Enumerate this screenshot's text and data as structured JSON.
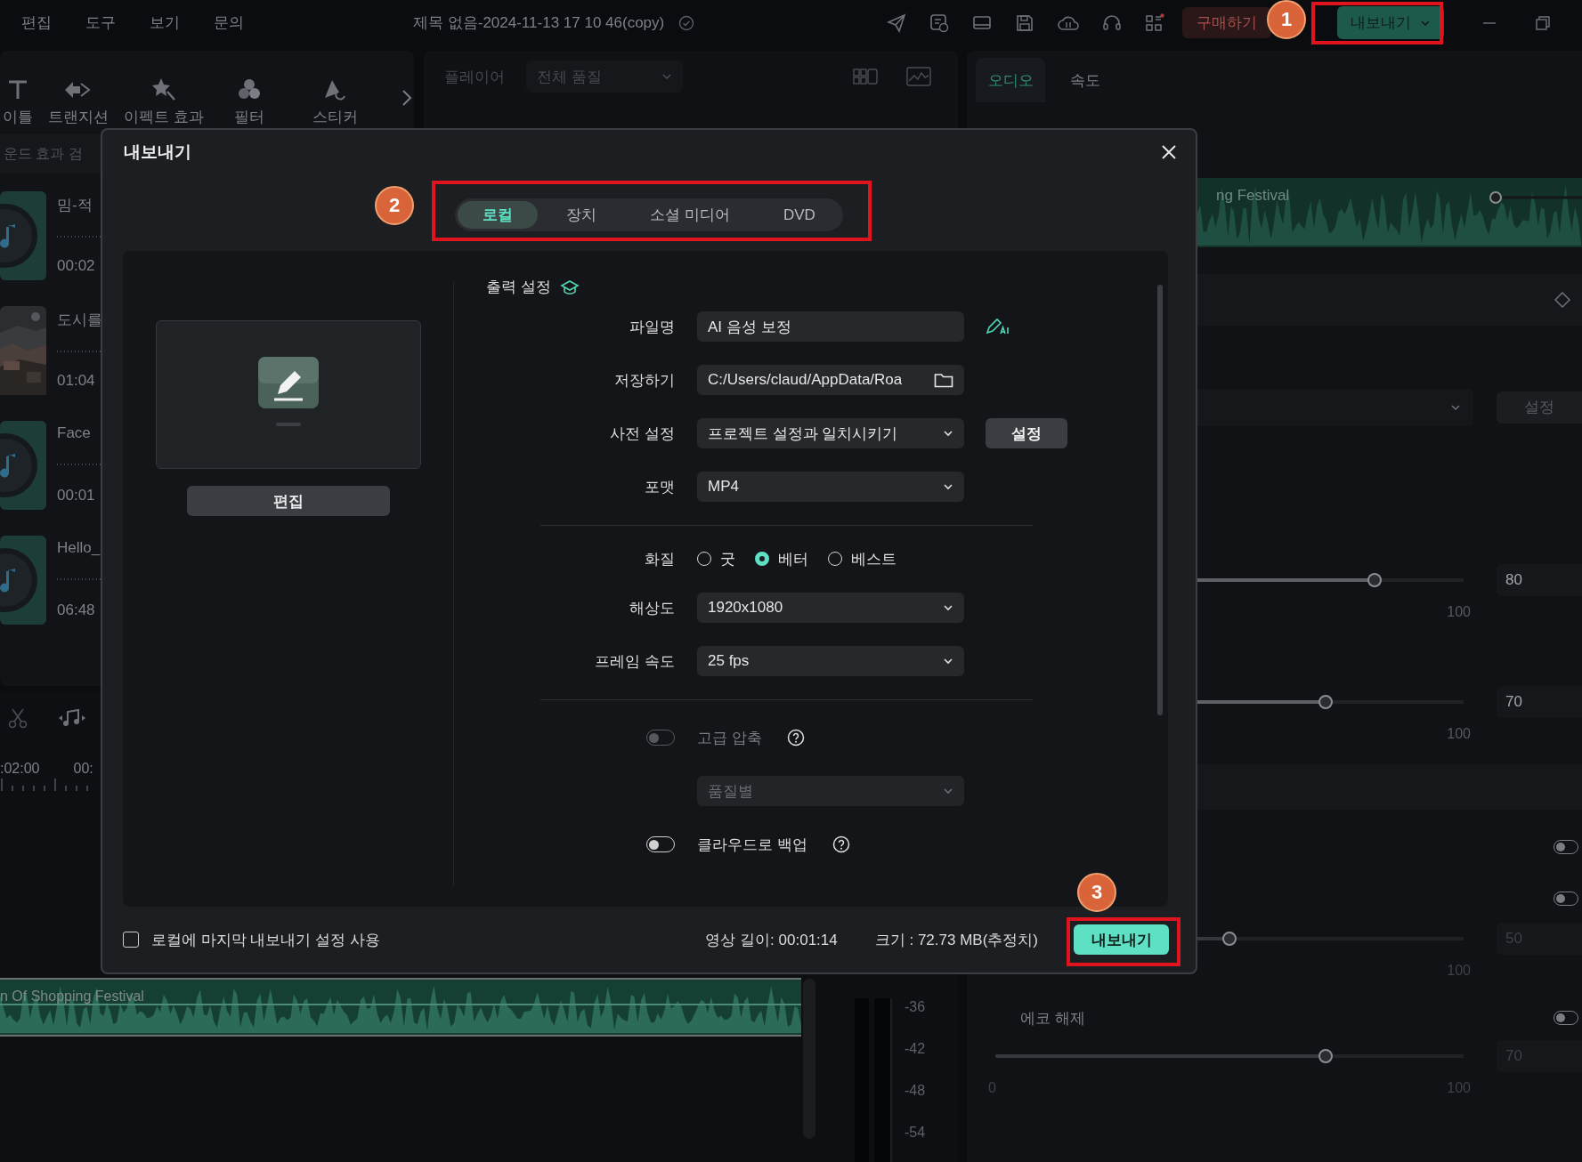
{
  "menu": [
    "편집",
    "도구",
    "보기",
    "문의"
  ],
  "title": "제목 없음-2024-11-13 17 10 46(copy)",
  "buy_button": "구매하기",
  "export_button": "내보내기",
  "tools": [
    "이틀",
    "트랜지션",
    "이펙트 효과",
    "필터",
    "스티커"
  ],
  "media_search": {
    "placeholder": "운드 효과 검"
  },
  "media": [
    {
      "kind": "audio",
      "name": "밈-적",
      "duration": "00:02"
    },
    {
      "kind": "picture",
      "name": "도시를",
      "duration": "01:04"
    },
    {
      "kind": "audio",
      "name": "Face",
      "duration": "00:01"
    },
    {
      "kind": "audio",
      "name": "Hello_",
      "duration": "06:48"
    }
  ],
  "player": {
    "title": "플레이어",
    "quality": "전체 품질"
  },
  "timeline": {
    "ruler": [
      ":02:00",
      "00:"
    ],
    "clip": "n Of Shopping Festival"
  },
  "meter": {
    "ticks": [
      "-36",
      "-42",
      "-48",
      "-54"
    ]
  },
  "right_panel": {
    "tabs": [
      {
        "label": "오디오",
        "selected": true
      },
      {
        "label": "속도",
        "selected": false
      }
    ],
    "clip_title": "ng Festival",
    "settings_button": "설정",
    "sliders": [
      {
        "level": 0.8,
        "value": "80",
        "max": "100",
        "disabled": false
      },
      {
        "level": 0.7,
        "value": "70",
        "max": "100",
        "disabled": false
      }
    ],
    "toggles": [
      {
        "on": false
      },
      {
        "on": false
      }
    ],
    "slider3": {
      "level": 0.5,
      "value": "50",
      "max": "100",
      "disabled": true
    },
    "echo": {
      "label": "에코 해제",
      "on": false,
      "level": 0.7,
      "value": "70",
      "min": "0",
      "max": "100",
      "disabled": true
    }
  },
  "dialog": {
    "title": "내보내기",
    "tabs": [
      {
        "label": "로컬",
        "selected": true
      },
      {
        "label": "장치",
        "selected": false
      },
      {
        "label": "소셜 미디어",
        "selected": false
      },
      {
        "label": "DVD",
        "selected": false
      }
    ],
    "edit_button": "편집",
    "section_title": "출력 설정",
    "rows": [
      {
        "kind": "text",
        "label": "파일명",
        "value": "AI 음성 보정"
      },
      {
        "kind": "path",
        "label": "저장하기",
        "value": "C:/Users/claud/AppData/Roa"
      },
      {
        "kind": "select",
        "label": "사전 설정",
        "value": "프로젝트 설정과 일치시키기",
        "button": "설정",
        "disabled": false
      },
      {
        "kind": "select",
        "label": "포맷",
        "value": "MP4",
        "disabled": false
      },
      {
        "kind": "divider"
      },
      {
        "kind": "radio",
        "label": "화질",
        "options": [
          {
            "label": "굿",
            "selected": false
          },
          {
            "label": "베터",
            "selected": true
          },
          {
            "label": "베스트",
            "selected": false
          }
        ]
      },
      {
        "kind": "select",
        "label": "해상도",
        "value": "1920x1080",
        "disabled": false
      },
      {
        "kind": "select",
        "label": "프레임 속도",
        "value": "25 fps",
        "disabled": false
      },
      {
        "kind": "divider"
      },
      {
        "kind": "toggle",
        "label": "고급 압축",
        "on": false,
        "disabled": true
      },
      {
        "kind": "select",
        "value": "품질별",
        "disabled": true
      },
      {
        "kind": "toggle",
        "label": "클라우드로 백업",
        "on": false,
        "disabled": false
      }
    ],
    "remember": {
      "label": "로컬에 마지막 내보내기 설정 사용",
      "checked": false
    },
    "duration": "영상 길이: 00:01:14",
    "size": "크기 : 72.73 MB(추정치)",
    "export_button": "내보내기"
  },
  "annotations": [
    {
      "number": "1"
    },
    {
      "number": "2"
    },
    {
      "number": "3"
    }
  ]
}
